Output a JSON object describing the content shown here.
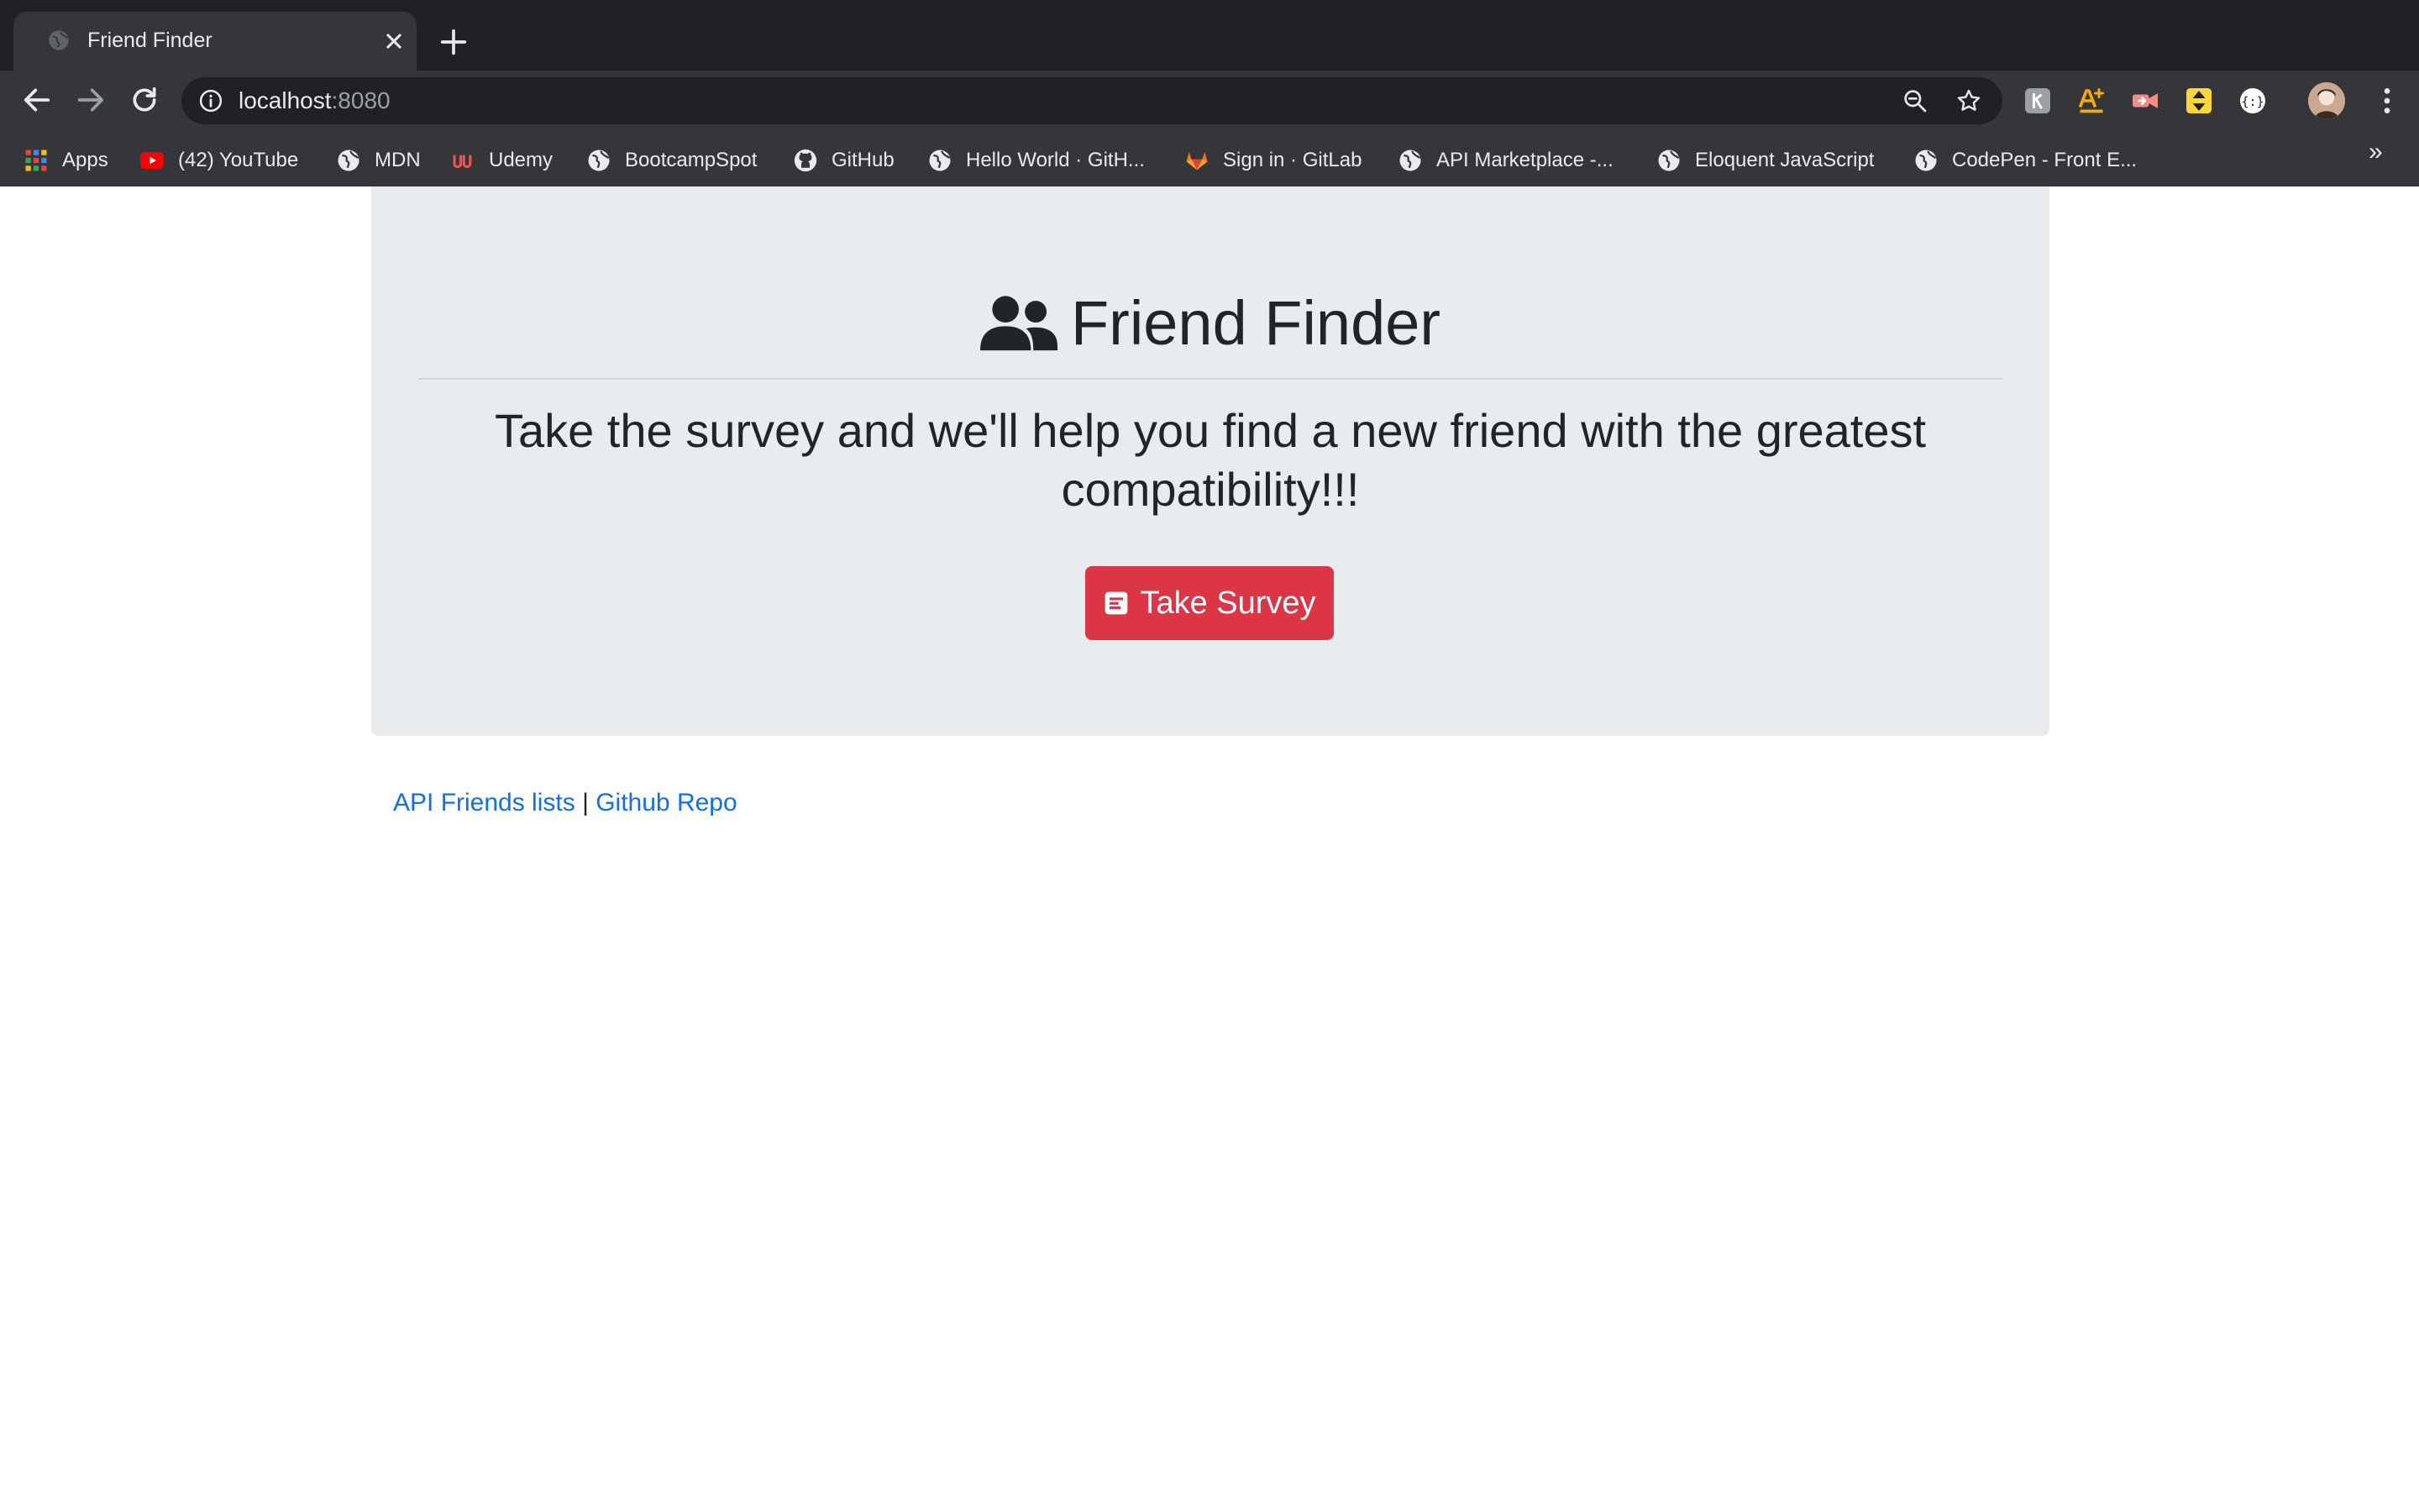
{
  "browser": {
    "tab": {
      "title": "Friend Finder"
    },
    "address_bar": {
      "host": "localhost",
      "port": ":8080"
    },
    "bookmarks": [
      {
        "label": "Apps",
        "icon": "apps-grid-icon"
      },
      {
        "label": "(42) YouTube",
        "icon": "youtube-icon"
      },
      {
        "label": "MDN",
        "icon": "globe-icon"
      },
      {
        "label": "Udemy",
        "icon": "udemy-icon"
      },
      {
        "label": "BootcampSpot",
        "icon": "globe-icon"
      },
      {
        "label": "GitHub",
        "icon": "github-icon"
      },
      {
        "label": "Hello World · GitH...",
        "icon": "globe-icon"
      },
      {
        "label": "Sign in · GitLab",
        "icon": "gitlab-icon"
      },
      {
        "label": "API Marketplace -...",
        "icon": "globe-icon"
      },
      {
        "label": "Eloquent JavaScript",
        "icon": "globe-icon"
      },
      {
        "label": "CodePen - Front E...",
        "icon": "globe-icon"
      }
    ],
    "more_bookmarks": "»"
  },
  "hero": {
    "title": "Friend Finder",
    "lead": "Take the survey and we'll help you find a new friend with the greatest compatibility!!!",
    "button_label": "Take Survey"
  },
  "footer": {
    "api_link": "API Friends lists",
    "separator": "|",
    "repo_link": "Github Repo"
  },
  "colors": {
    "chrome_dark": "#202124",
    "chrome_toolbar": "#35363a",
    "jumbotron_bg": "#e9ecef",
    "button_danger": "#dc3545",
    "link_blue": "#0d6efd",
    "text_dark": "#212529"
  }
}
